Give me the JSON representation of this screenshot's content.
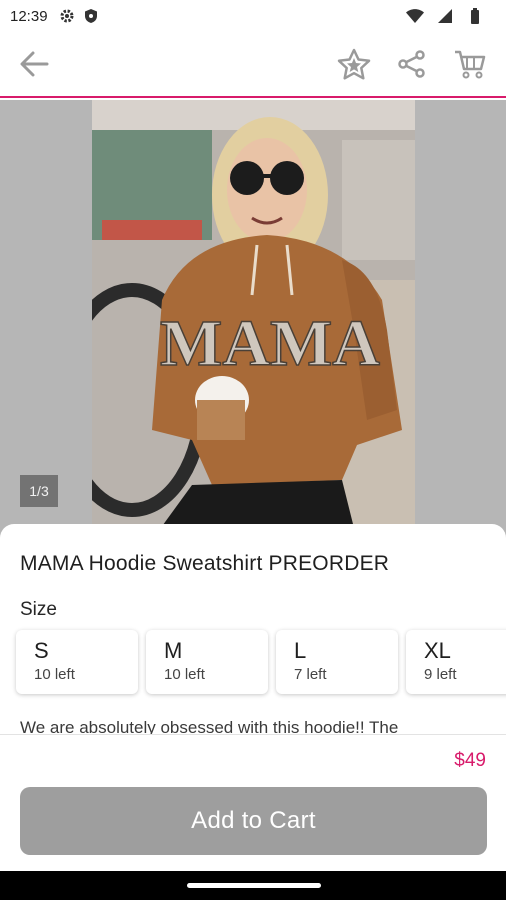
{
  "status_bar": {
    "time": "12:39",
    "icons": [
      "gear-icon",
      "shield-icon",
      "wifi-icon",
      "signal-icon",
      "battery-icon"
    ]
  },
  "app_bar": {
    "icons": [
      "back-arrow-icon",
      "star-icon",
      "share-icon",
      "cart-icon"
    ],
    "accent_color": "#d81b6b"
  },
  "gallery": {
    "counter": "1/3",
    "photo_print": "MAMA"
  },
  "product": {
    "title": "MAMA Hoodie Sweatshirt PREORDER",
    "size_label": "Size",
    "sizes": [
      {
        "name": "S",
        "stock": "10 left"
      },
      {
        "name": "M",
        "stock": "10 left"
      },
      {
        "name": "L",
        "stock": "7 left"
      },
      {
        "name": "XL",
        "stock": "9 left"
      }
    ],
    "description": "We are absolutely obsessed with this hoodie!! The"
  },
  "footer": {
    "price": "$49",
    "add_to_cart_label": "Add to Cart",
    "button_color": "#9e9e9e"
  }
}
